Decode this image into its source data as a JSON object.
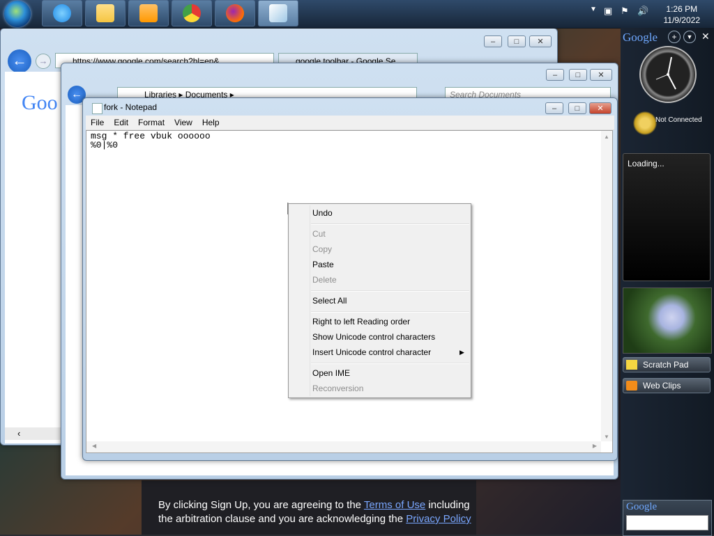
{
  "taskbar": {
    "apps": [
      {
        "name": "internet-explorer",
        "color": "#1e88e5"
      },
      {
        "name": "windows-explorer",
        "color": "#f5c542"
      },
      {
        "name": "media-player",
        "color": "#ff9800"
      },
      {
        "name": "chrome",
        "color": "#e53935"
      },
      {
        "name": "firefox",
        "color": "#ff6f00"
      },
      {
        "name": "notepad",
        "color": "#cfe7f5"
      }
    ],
    "time": "1:26 PM",
    "date": "11/9/2022",
    "tray_icons": [
      "chevron-up-icon",
      "network-icon",
      "flag-icon",
      "speaker-icon"
    ]
  },
  "browser": {
    "address": "https://www.google.com/search?hl=en&",
    "tab_title": "google toolbar - Google Se...",
    "logo_text": "Goo"
  },
  "explorer": {
    "breadcrumb": [
      "Libraries",
      "Documents"
    ],
    "search_placeholder": "Search Documents"
  },
  "notepad": {
    "title": "fork - Notepad",
    "menu": [
      "File",
      "Edit",
      "Format",
      "View",
      "Help"
    ],
    "lines": [
      "msg * free vbuk oooooo",
      "%0|%0"
    ]
  },
  "context_menu": {
    "items": [
      {
        "label": "Undo",
        "enabled": true
      },
      {
        "label": "Cut",
        "enabled": false
      },
      {
        "label": "Copy",
        "enabled": false
      },
      {
        "label": "Paste",
        "enabled": true
      },
      {
        "label": "Delete",
        "enabled": false
      },
      {
        "label": "Select All",
        "enabled": true
      },
      {
        "label": "Right to left Reading order",
        "enabled": true
      },
      {
        "label": "Show Unicode control characters",
        "enabled": true
      },
      {
        "label": "Insert Unicode control character",
        "enabled": true
      },
      {
        "label": "Open IME",
        "enabled": true
      },
      {
        "label": "Reconversion",
        "enabled": false
      }
    ]
  },
  "sidebar": {
    "brand": "Google",
    "weather_status": "Not Connected",
    "feed_status": "Loading...",
    "scratch_pad": "Scratch Pad",
    "web_clips": "Web Clips",
    "search_brand": "Google"
  },
  "web_footer": {
    "text_1": "By clicking Sign Up, you are agreeing to the ",
    "terms_link": "Terms of Use",
    "text_2": " including the arbitration clause and you are acknowledging the ",
    "privacy_link": "Privacy Policy"
  }
}
